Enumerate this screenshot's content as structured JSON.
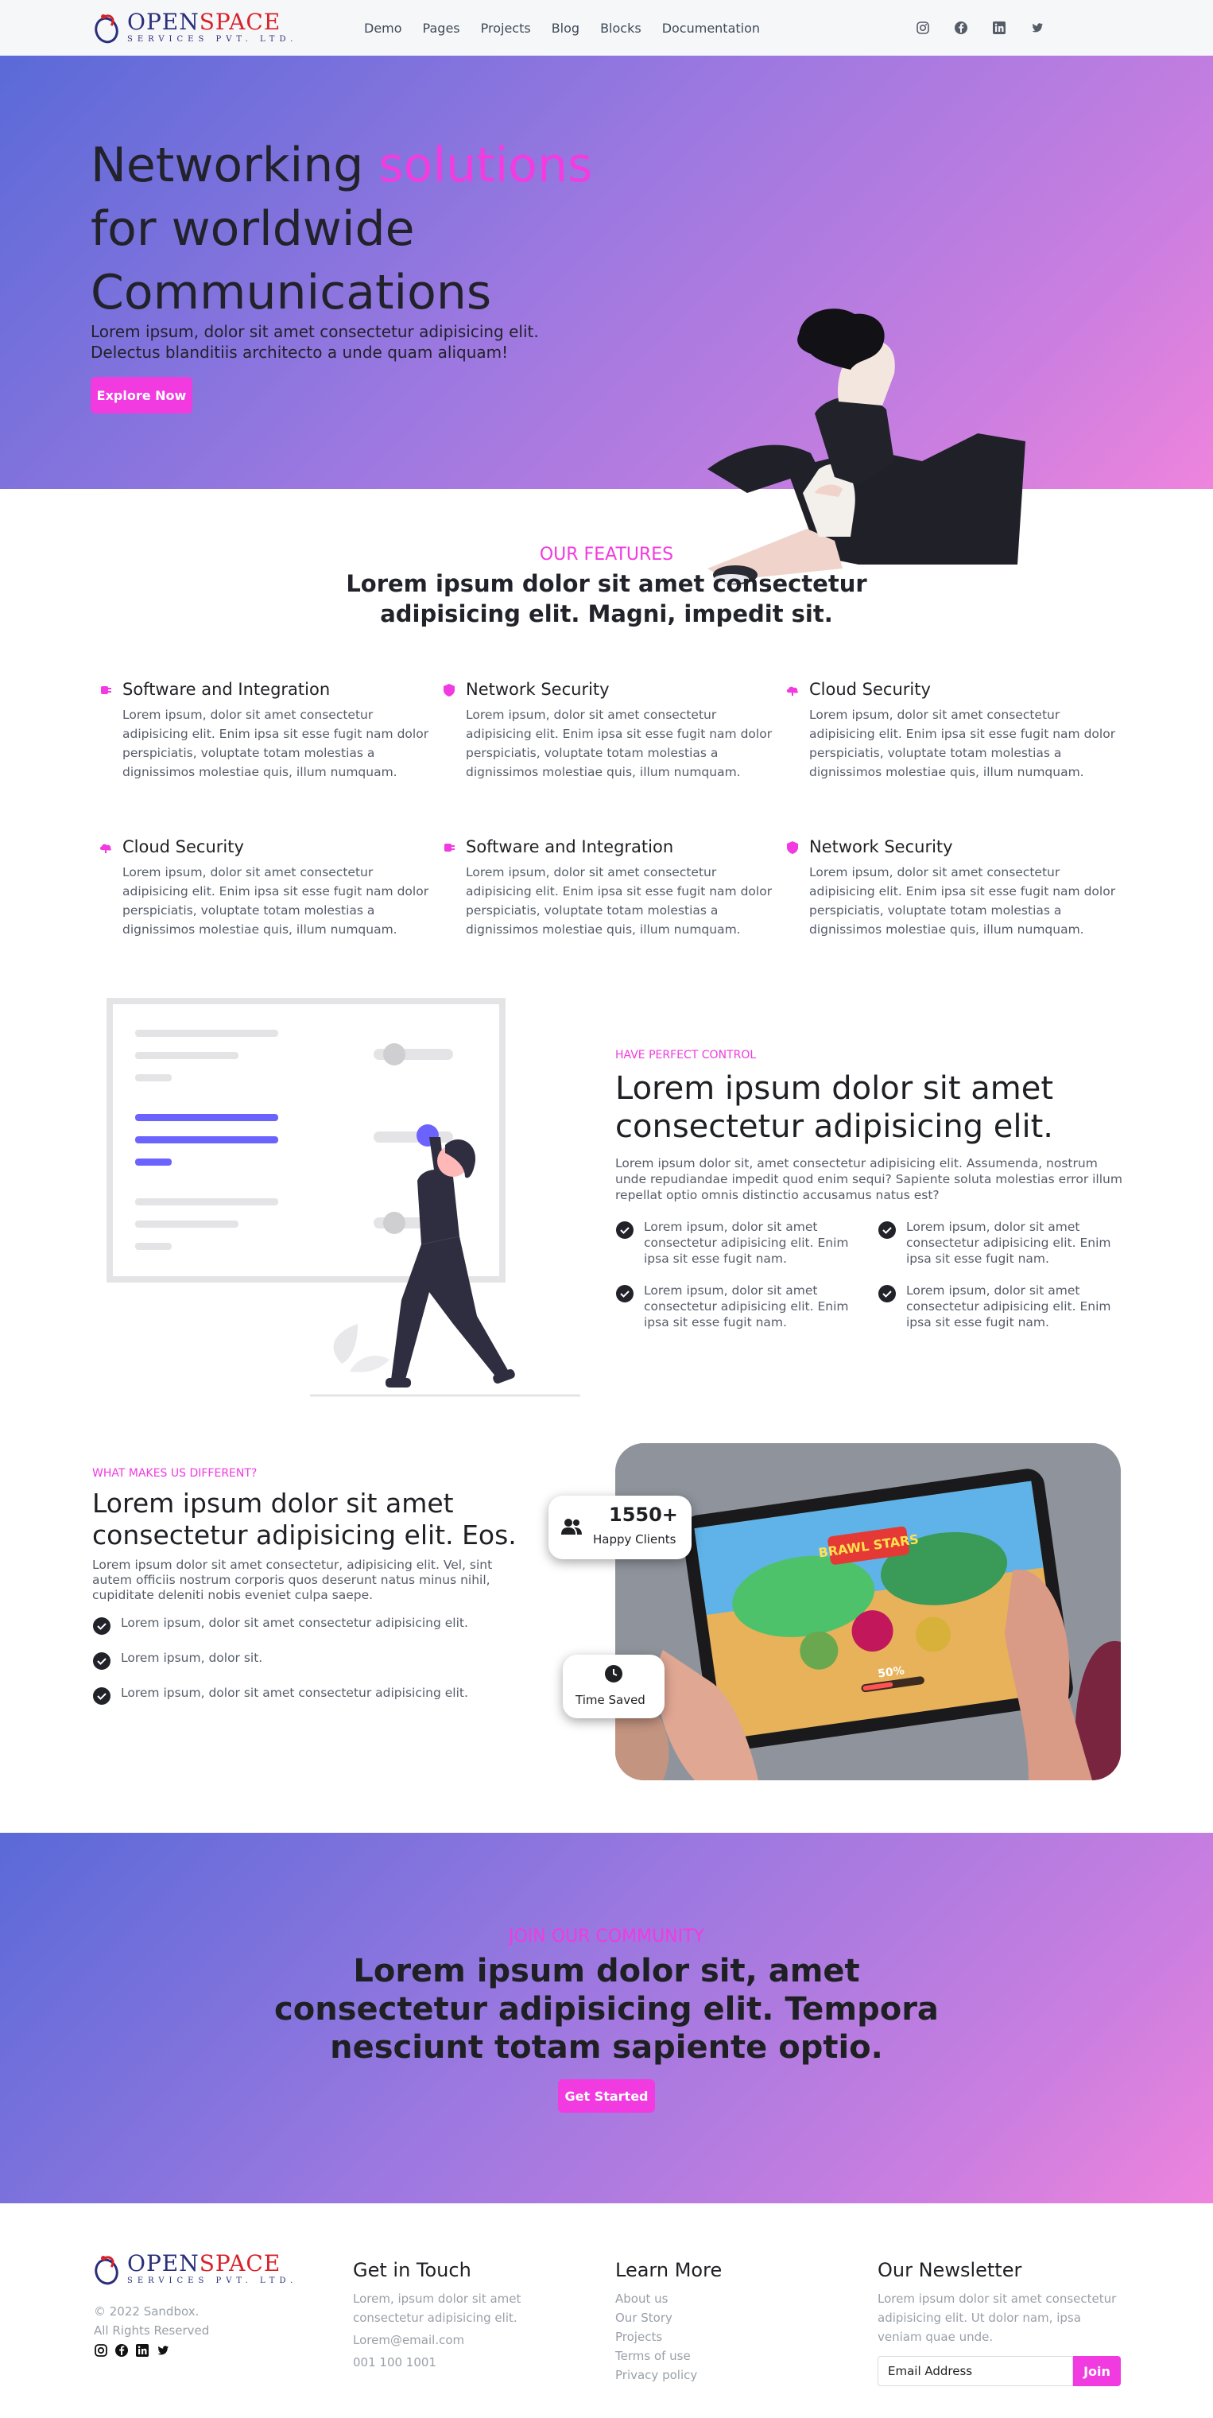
{
  "brand": {
    "logo_open": "OPEN",
    "logo_space": "SPACE",
    "logo_sub": "SERVICES PVT. LTD."
  },
  "nav": {
    "links": [
      "Demo",
      "Pages",
      "Projects",
      "Blog",
      "Blocks",
      "Documentation"
    ],
    "social_icons": [
      "instagram-icon",
      "facebook-icon",
      "linkedin-icon",
      "twitter-icon"
    ]
  },
  "hero": {
    "title_start": "Networking ",
    "title_accent": "solutions",
    "title_end": "for worldwide Communications",
    "subtitle": "Lorem ipsum, dolor sit amet consectetur adipisicing elit. Delectus blanditiis architecto a unde quam aliquam!",
    "cta": "Explore Now"
  },
  "features": {
    "eyebrow": "OUR FEATURES",
    "title": "Lorem ipsum dolor sit amet consectetur adipisicing elit. Magni, impedit sit.",
    "items": [
      {
        "icon": "plug-icon",
        "title": "Software and Integration",
        "text": "Lorem ipsum, dolor sit amet consectetur adipisicing elit. Enim ipsa sit esse fugit nam dolor perspiciatis, voluptate totam molestias a dignissimos molestiae quis, illum numquam."
      },
      {
        "icon": "shield-icon",
        "title": "Network Security",
        "text": "Lorem ipsum, dolor sit amet consectetur adipisicing elit. Enim ipsa sit esse fugit nam dolor perspiciatis, voluptate totam molestias a dignissimos molestiae quis, illum numquam."
      },
      {
        "icon": "cloud-icon",
        "title": "Cloud Security",
        "text": "Lorem ipsum, dolor sit amet consectetur adipisicing elit. Enim ipsa sit esse fugit nam dolor perspiciatis, voluptate totam molestias a dignissimos molestiae quis, illum numquam."
      },
      {
        "icon": "cloud-icon",
        "title": "Cloud Security",
        "text": "Lorem ipsum, dolor sit amet consectetur adipisicing elit. Enim ipsa sit esse fugit nam dolor perspiciatis, voluptate totam molestias a dignissimos molestiae quis, illum numquam."
      },
      {
        "icon": "plug-icon",
        "title": "Software and Integration",
        "text": "Lorem ipsum, dolor sit amet consectetur adipisicing elit. Enim ipsa sit esse fugit nam dolor perspiciatis, voluptate totam molestias a dignissimos molestiae quis, illum numquam."
      },
      {
        "icon": "shield-icon",
        "title": "Network Security",
        "text": "Lorem ipsum, dolor sit amet consectetur adipisicing elit. Enim ipsa sit esse fugit nam dolor perspiciatis, voluptate totam molestias a dignissimos molestiae quis, illum numquam."
      }
    ]
  },
  "control": {
    "eyebrow": "HAVE PERFECT CONTROL",
    "title": "Lorem ipsum dolor sit amet consectetur adipisicing elit.",
    "body": "Lorem ipsum dolor sit, amet consectetur adipisicing elit. Assumenda, nostrum unde repudiandae impedit quod enim sequi? Sapiente soluta molestias error illum repellat optio omnis distinctio accusamus natus est?",
    "points": [
      "Lorem ipsum, dolor sit amet consectetur adipisicing elit. Enim ipsa sit esse fugit nam.",
      "Lorem ipsum, dolor sit amet consectetur adipisicing elit. Enim ipsa sit esse fugit nam.",
      "Lorem ipsum, dolor sit amet consectetur adipisicing elit. Enim ipsa sit esse fugit nam.",
      "Lorem ipsum, dolor sit amet consectetur adipisicing elit. Enim ipsa sit esse fugit nam."
    ]
  },
  "different": {
    "eyebrow": "WHAT MAKES US DIFFERENT?",
    "title": "Lorem ipsum dolor sit amet consectetur adipisicing elit. Eos.",
    "body": "Lorem ipsum dolor sit amet consectetur, adipisicing elit. Vel, sint autem officiis nostrum corporis quos deserunt natus minus nihil, cupiditate deleniti nobis eveniet culpa saepe.",
    "points": [
      "Lorem ipsum, dolor sit amet consectetur adipisicing elit.",
      "Lorem ipsum, dolor sit.",
      "Lorem ipsum, dolor sit amet consectetur adipisicing elit."
    ],
    "clients_count": "1550+",
    "clients_label": "Happy Clients",
    "saved_label": "Time Saved",
    "game_title": "BRAWL STARS",
    "game_progress": "50%"
  },
  "community": {
    "eyebrow": "JOIN OUR COMMUNITY",
    "title": "Lorem ipsum dolor sit, amet consectetur adipisicing elit. Tempora nesciunt totam sapiente optio.",
    "cta": "Get Started"
  },
  "footer": {
    "copyright": "© 2022 Sandbox.",
    "rights": "All Rights Reserved",
    "contact": {
      "title": "Get in Touch",
      "text": "Lorem, ipsum dolor sit amet consectetur adipisicing elit.",
      "email": "Lorem@email.com",
      "phone": "001 100 1001"
    },
    "learn": {
      "title": "Learn More",
      "links": [
        "About us",
        "Our Story",
        "Projects",
        "Terms of use",
        "Privacy policy"
      ]
    },
    "newsletter": {
      "title": "Our Newsletter",
      "text": "Lorem ipsum dolor sit amet consectetur adipisicing elit. Ut dolor nam, ipsa veniam quae unde.",
      "placeholder": "Email Address",
      "button": "Join"
    }
  },
  "colors": {
    "accent": "#f13ae0",
    "text": "#1f2024",
    "muted": "#555c68"
  }
}
